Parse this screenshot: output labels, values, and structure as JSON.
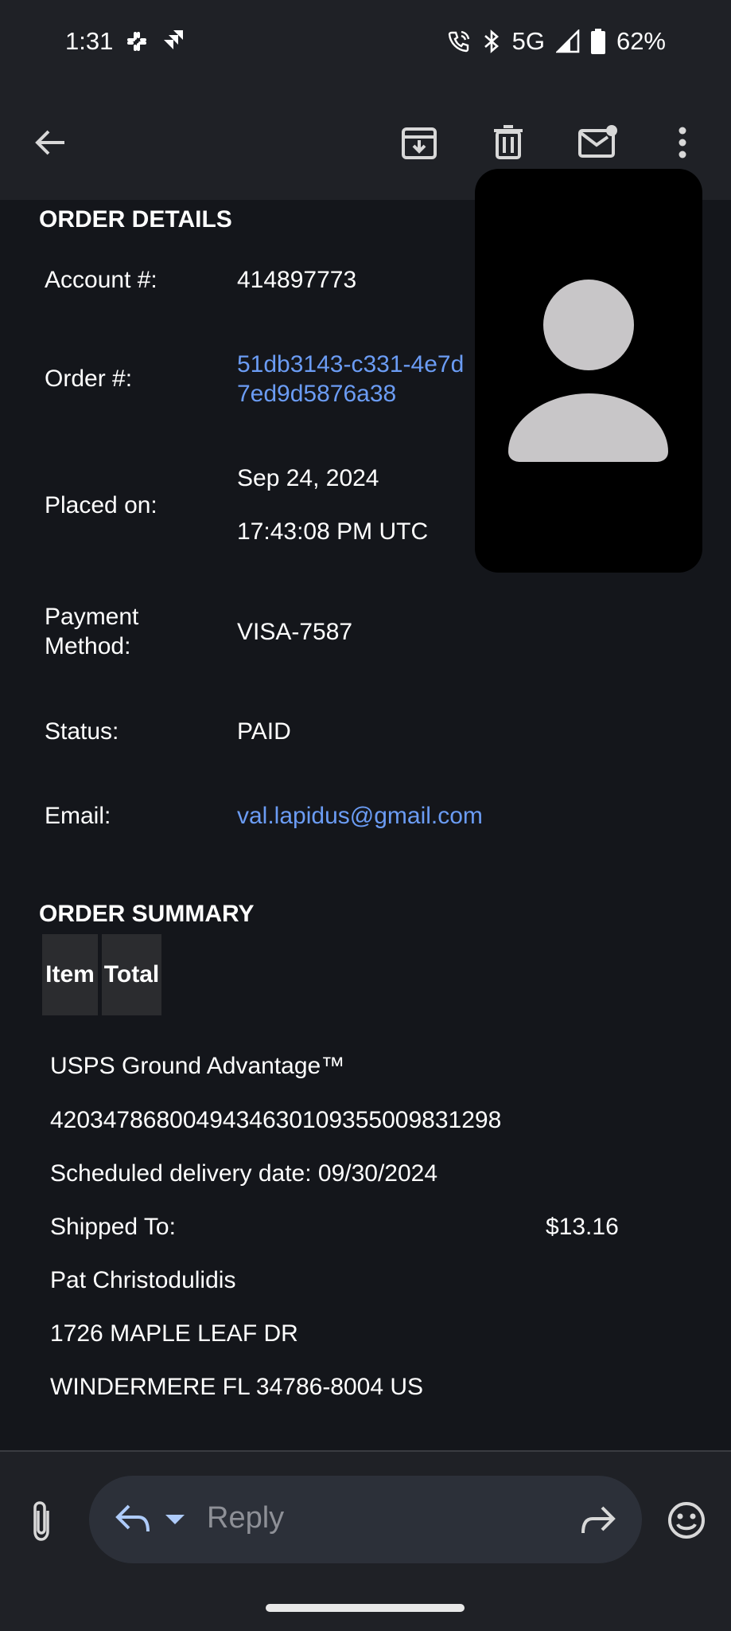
{
  "status_bar": {
    "time": "1:31",
    "network": "5G",
    "battery": "62%",
    "icons": [
      "slack-icon",
      "jira-icon",
      "wifi-calling-icon",
      "bluetooth-icon",
      "signal-icon",
      "battery-icon"
    ]
  },
  "toolbar": {
    "icons": [
      "back-arrow-icon",
      "archive-icon",
      "delete-icon",
      "mark-unread-icon",
      "more-vert-icon"
    ]
  },
  "order_details": {
    "title": "ORDER DETAILS",
    "account_label": "Account #:",
    "account_value": "414897773",
    "order_label": "Order #:",
    "order_value_line1": "51db3143-c331-4e7d",
    "order_value_line2": "7ed9d5876a38",
    "placed_label": "Placed on:",
    "placed_date": "Sep 24, 2024",
    "placed_time": "17:43:08 PM UTC",
    "payment_label_line1": "Payment",
    "payment_label_line2": "Method:",
    "payment_value": "VISA-7587",
    "status_label": "Status:",
    "status_value": "PAID",
    "email_label": "Email:",
    "email_value": "val.lapidus@gmail.com"
  },
  "order_summary": {
    "title": "ORDER SUMMARY",
    "headers": [
      "Item",
      "Total"
    ],
    "shipping_service": "USPS Ground Advantage™",
    "tracking_number": "420347868004943463010935500983129​8",
    "delivery_date": "Scheduled delivery date: 09/30/2024",
    "shipped_to_label": "Shipped To:",
    "total": "$13.16",
    "recipient": "Pat Christodulidis",
    "address_line1": "1726 MAPLE LEAF DR",
    "address_line2": "WINDERMERE FL 34786-8004 US"
  },
  "bottom_bar": {
    "reply_placeholder": "Reply"
  },
  "colors": {
    "background": "#14161b",
    "bar": "#1f2126",
    "link": "#6b9cf4"
  }
}
